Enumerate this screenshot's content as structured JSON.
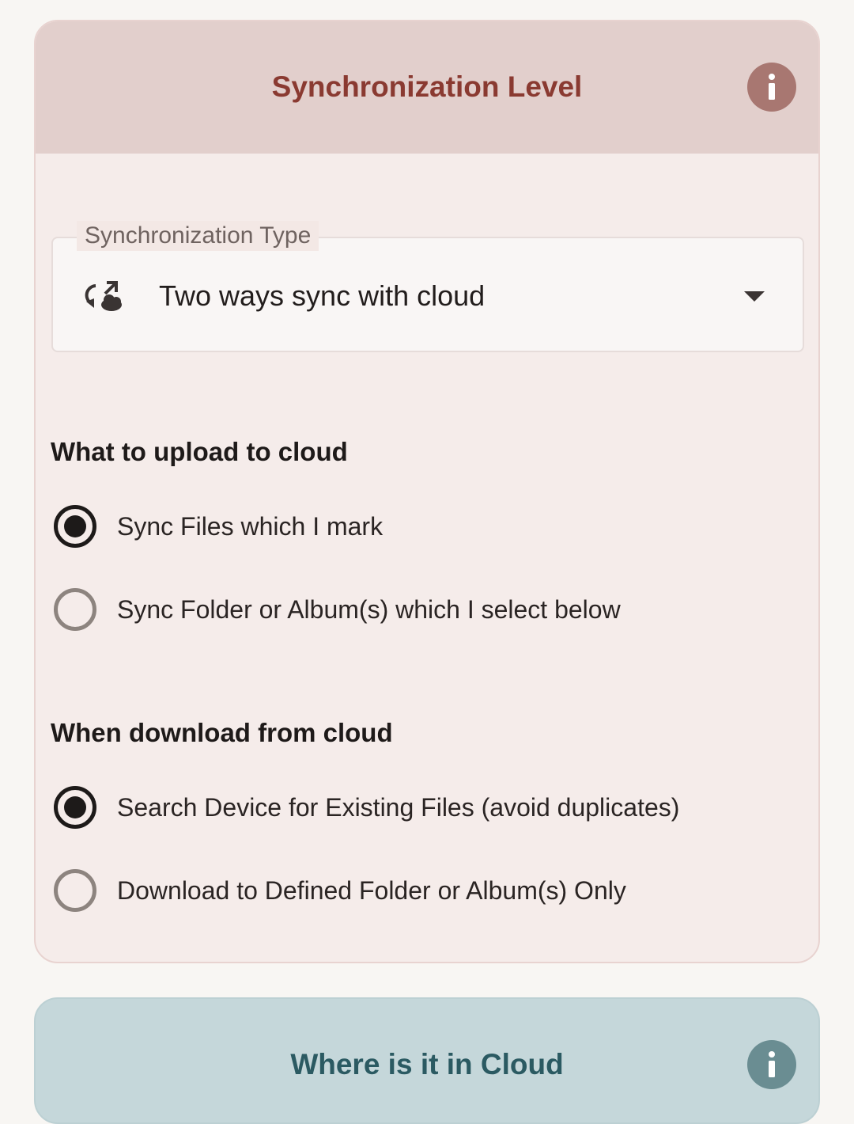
{
  "sync_card": {
    "title": "Synchronization Level",
    "info_icon": "info-icon",
    "sync_type": {
      "label": "Synchronization Type",
      "value": "Two ways sync with cloud",
      "icon": "sync-cloud-icon"
    },
    "upload_section": {
      "heading": "What to upload to cloud",
      "options": [
        {
          "label": "Sync Files which I mark",
          "selected": true
        },
        {
          "label": "Sync Folder or Album(s) which I select below",
          "selected": false
        }
      ]
    },
    "download_section": {
      "heading": "When download from cloud",
      "options": [
        {
          "label": "Search Device for Existing Files (avoid duplicates)",
          "selected": true
        },
        {
          "label": "Download to Defined Folder or Album(s) Only",
          "selected": false
        }
      ]
    }
  },
  "cloud_card": {
    "title": "Where is it in Cloud",
    "info_icon": "info-icon"
  },
  "colors": {
    "sync_header_bg": "#e2cfcc",
    "sync_title": "#8a3a31",
    "cloud_header_bg": "#c5d7da",
    "cloud_title": "#2b5a62"
  }
}
